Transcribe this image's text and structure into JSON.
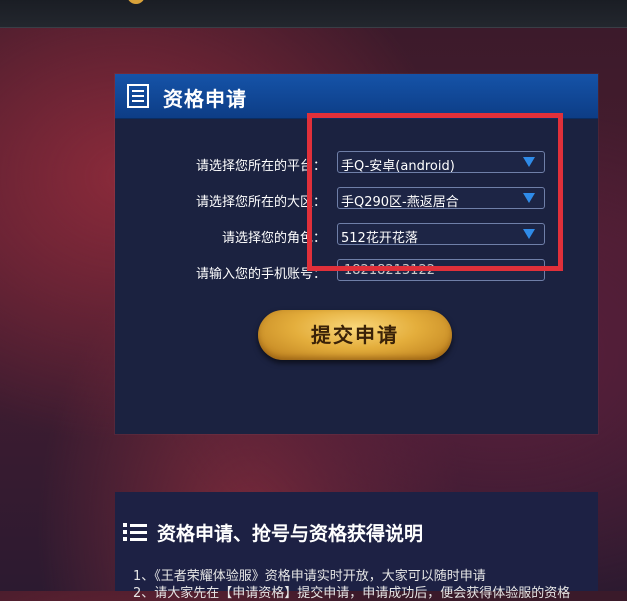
{
  "topbar": {},
  "application_panel": {
    "title": "资格申请",
    "fields": [
      {
        "label": "请选择您所在的平台：",
        "value": "手Q-安卓(android)",
        "type": "select"
      },
      {
        "label": "请选择您所在的大区：",
        "value": "手Q290区-燕返居合",
        "type": "select"
      },
      {
        "label": "请选择您的角色：",
        "value": "512花开花落",
        "type": "select"
      },
      {
        "label": "请输入您的手机账号：",
        "value": "18218213122",
        "type": "input"
      }
    ],
    "submit_label": "提交申请"
  },
  "highlight": {
    "color": "#e0303a"
  },
  "info": {
    "heading": "资格申请、抢号与资格获得说明",
    "lines": [
      "1、《王者荣耀体验服》资格申请实时开放，大家可以随时申请",
      "2、请大家先在【申请资格】提交申请，申请成功后，便会获得体验服的资格"
    ]
  },
  "colors": {
    "header_blue": "#1553a8",
    "arrow_blue": "#2f8be8",
    "gold": "#e4ae3c"
  }
}
